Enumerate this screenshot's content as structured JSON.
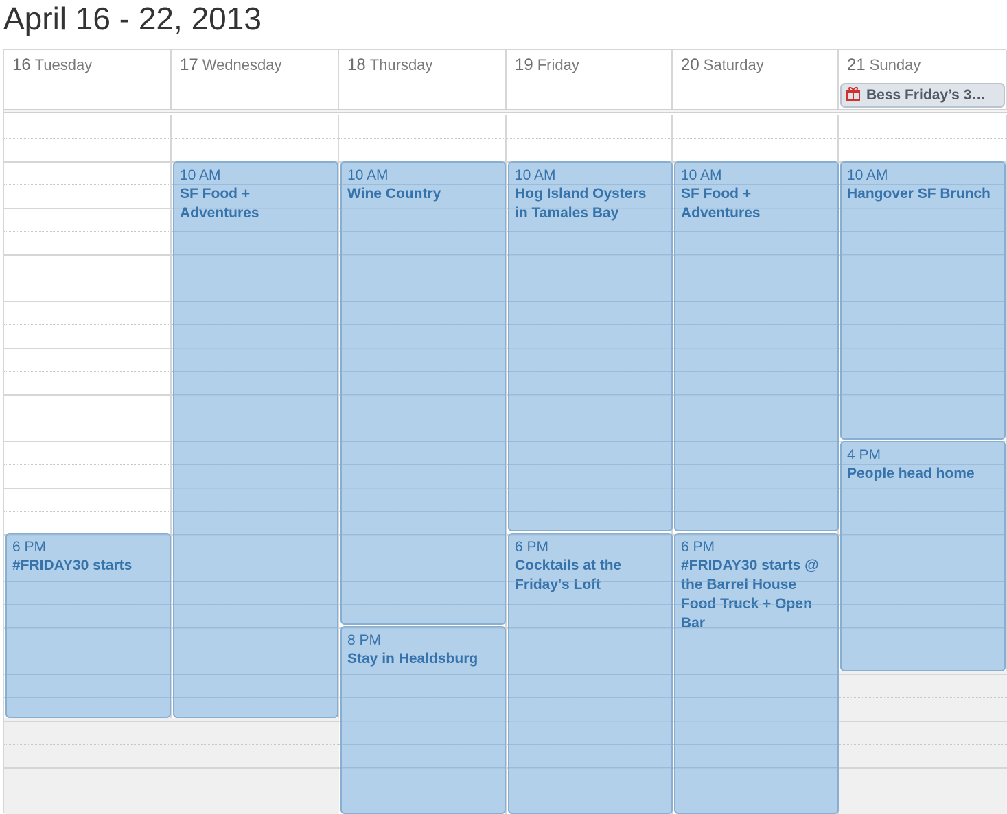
{
  "title": "April 16 - 22, 2013",
  "days": [
    {
      "num": "16",
      "name": "Tuesday"
    },
    {
      "num": "17",
      "name": "Wednesday"
    },
    {
      "num": "18",
      "name": "Thursday"
    },
    {
      "num": "19",
      "name": "Friday"
    },
    {
      "num": "20",
      "name": "Saturday"
    },
    {
      "num": "21",
      "name": "Sunday"
    }
  ],
  "allday_event": {
    "label": "Bess Friday’s 3…",
    "icon": "gift-icon",
    "color": "#d0312d"
  },
  "events": [
    {
      "day": 0,
      "time": "6 PM",
      "name": "#FRIDAY30 starts"
    },
    {
      "day": 1,
      "time": "10 AM",
      "name": "SF  Food + Adventures"
    },
    {
      "day": 2,
      "time": "10 AM",
      "name": "Wine Country"
    },
    {
      "day": 2,
      "time": "8 PM",
      "name": "Stay in Healdsburg"
    },
    {
      "day": 3,
      "time": "10 AM",
      "name": "Hog Island Oysters in Tamales Bay"
    },
    {
      "day": 3,
      "time": "6 PM",
      "name": "Cocktails at the Friday's Loft"
    },
    {
      "day": 4,
      "time": "10 AM",
      "name": "SF  Food + Adventures"
    },
    {
      "day": 4,
      "time": "6 PM",
      "name": "#FRIDAY30 starts @ the Barrel House Food Truck + Open Bar"
    },
    {
      "day": 5,
      "time": "10 AM",
      "name": "Hangover SF Brunch"
    },
    {
      "day": 5,
      "time": "4 PM",
      "name": "People head home"
    }
  ],
  "colors": {
    "event_bg": "#b3cfe8",
    "event_border": "#88aed1",
    "event_text": "#3773ab"
  }
}
